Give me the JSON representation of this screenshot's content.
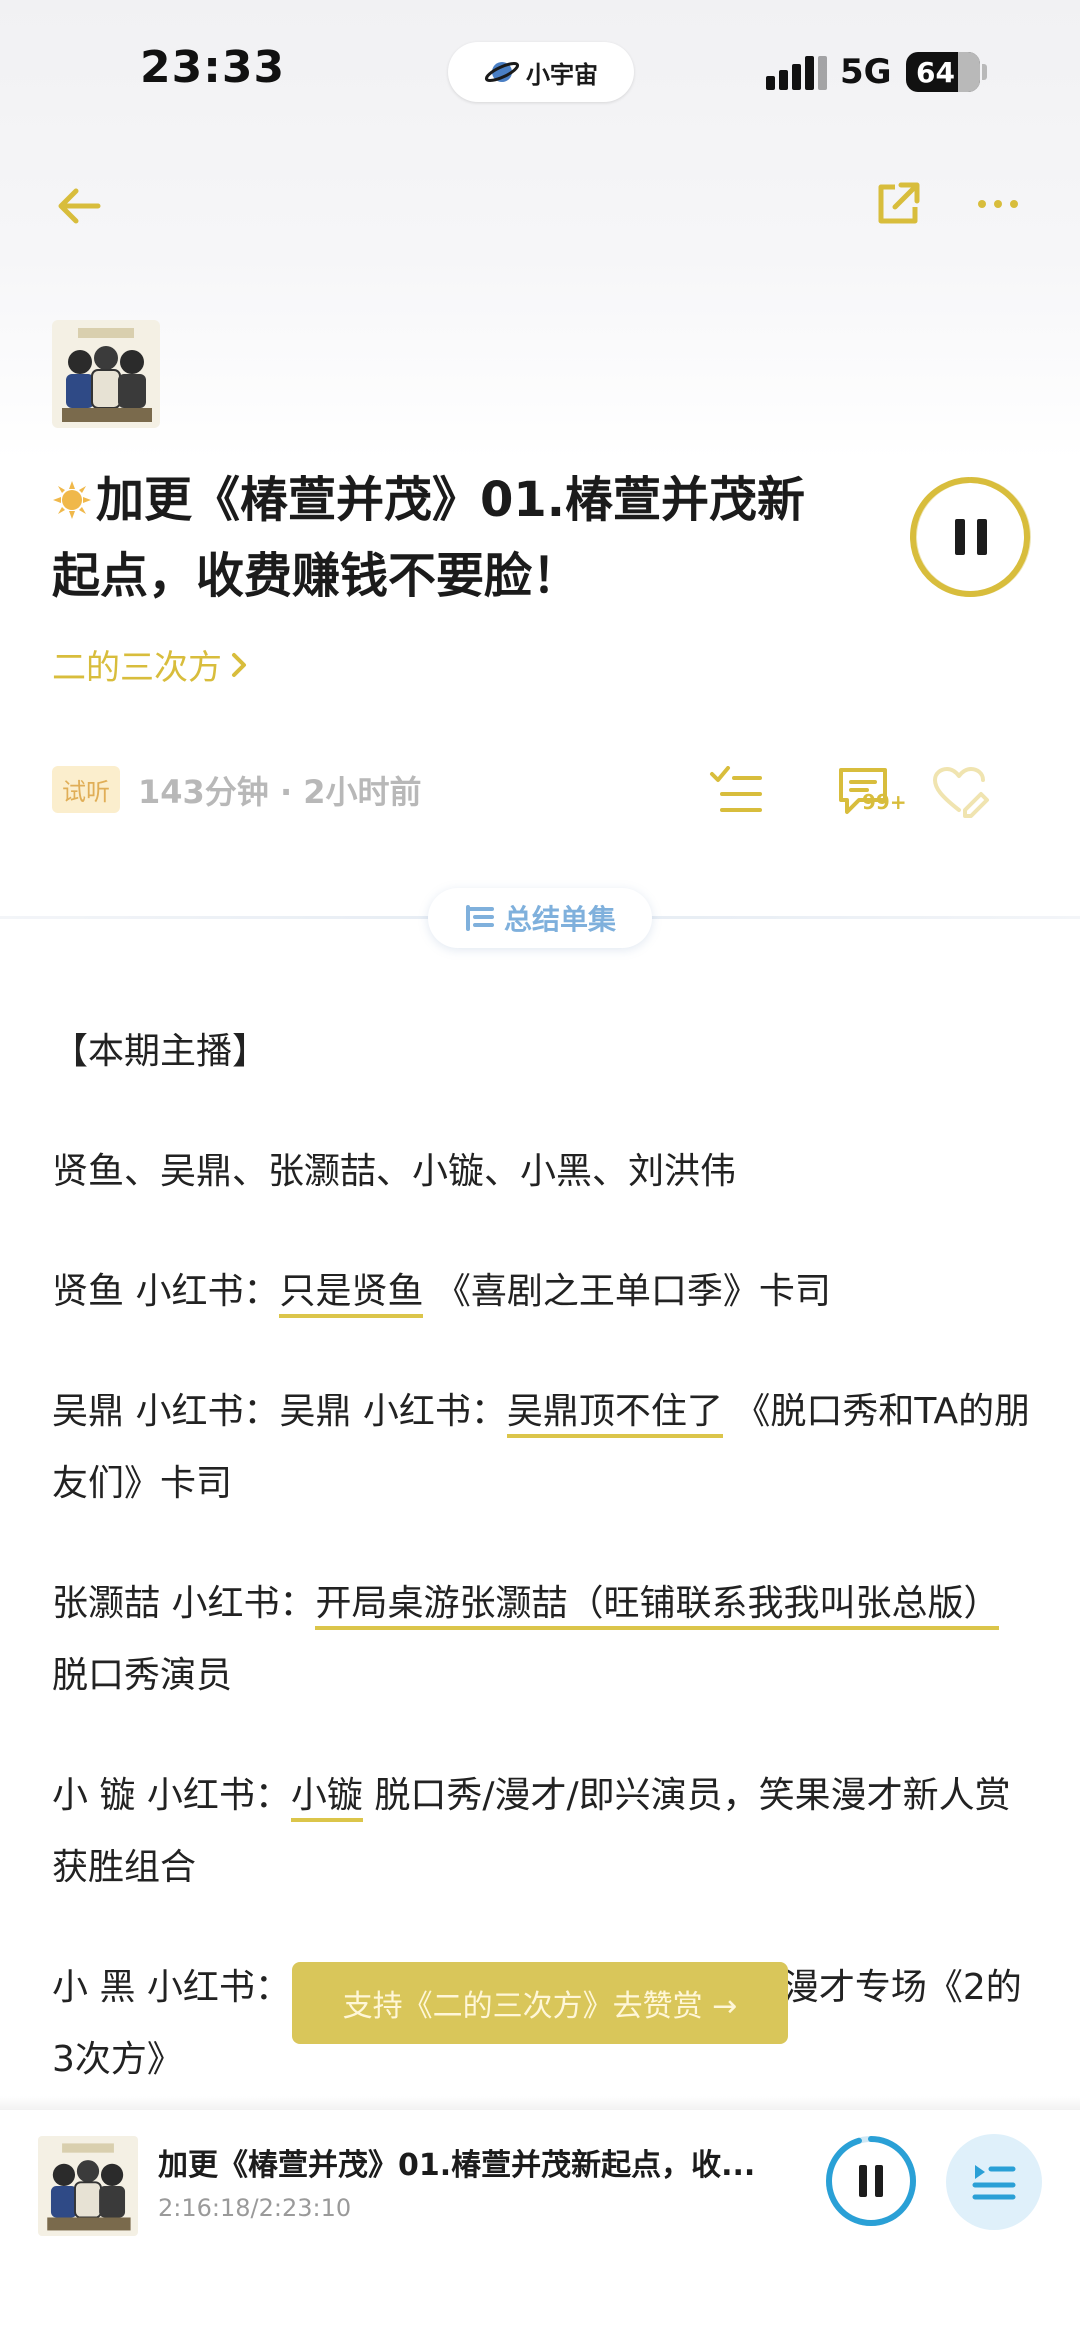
{
  "status_bar": {
    "time": "23:33",
    "island_label": "小宇宙",
    "network": "5G",
    "battery": "64"
  },
  "nav": {
    "back_icon": "arrow-left-icon",
    "share_icon": "share-icon",
    "more_icon": "more-horizontal-icon"
  },
  "episode": {
    "title": "加更《椿萱并茂》01.椿萱并茂新起点，收费赚钱不要脸！",
    "channel": "二的三次方",
    "trial_badge": "试听",
    "meta": "143分钟 · 2小时前",
    "comment_count": "99+",
    "summary_button": "总结单集"
  },
  "colors": {
    "accent": "#d8bd3c",
    "donate_bg": "#d9c65a",
    "summary_blue": "#7fb0dc",
    "player_blue": "#2aa0d6"
  },
  "description": {
    "p1": "【本期主播】",
    "p2": "贤鱼、吴鼎、张灏喆、小镟、小黑、刘洪伟",
    "p3": {
      "a": "贤鱼 小红书：",
      "link": "只是贤鱼",
      "b": " 《喜剧之王单口季》卡司"
    },
    "p4": {
      "a": "吴鼎 小红书：吴鼎 小红书：",
      "link": "吴鼎顶不住了",
      "b": " 《脱口秀和TA的朋友们》卡司"
    },
    "p5": {
      "a": "张灏喆 小红书：",
      "link": "开局桌游张灏喆（旺铺联系我我叫张总版）",
      "b": " 脱口秀演员"
    },
    "p6": {
      "a": "小 镟 小红书：",
      "link": "小镟",
      "b": " 脱口秀/漫才/即兴演员，笑果漫才新人赏获胜组合"
    },
    "p7": {
      "a": "小 黑 小红书：",
      "b": "五季》卡司，漫才专场《2的3次方》"
    }
  },
  "donate": {
    "label": "支持《二的三次方》去赞赏 →"
  },
  "player": {
    "title": "加更《椿萱并茂》01.椿萱并茂新起点，收...",
    "time": "2:16:18/2:23:10",
    "progress": 0.952
  }
}
